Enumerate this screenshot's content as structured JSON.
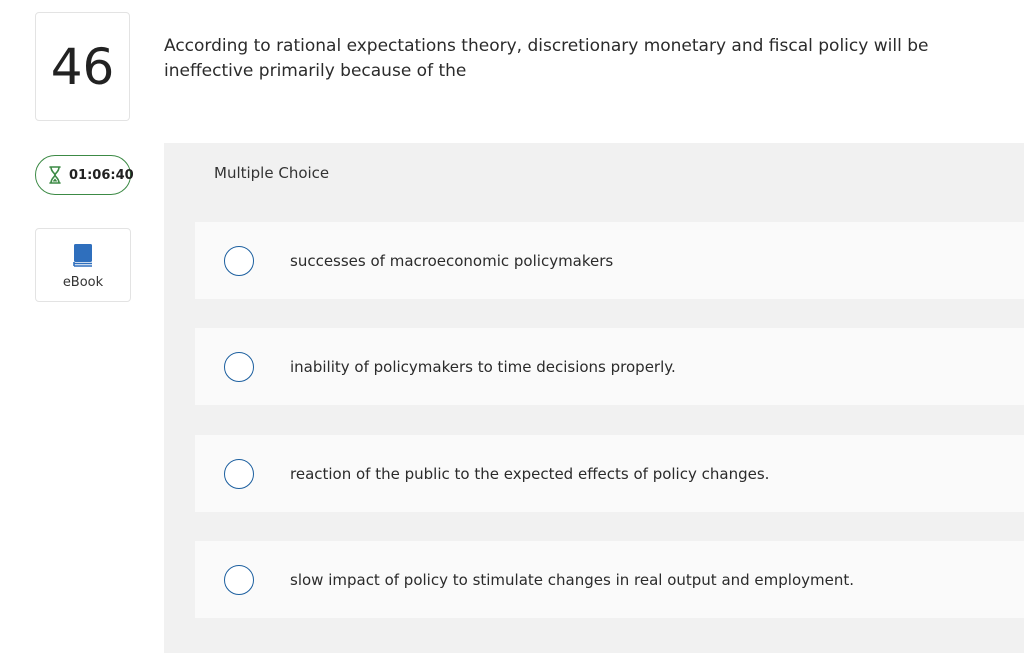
{
  "question_number": "46",
  "timer": {
    "value": "01:06:40",
    "icon": "hourglass-icon"
  },
  "ebook": {
    "label": "eBook",
    "icon": "book-icon"
  },
  "question": {
    "text": "According to rational expectations theory, discretionary monetary and fiscal policy will be ineffective primarily because of the"
  },
  "answer_panel": {
    "type_label": "Multiple Choice",
    "choices": [
      {
        "text": "successes of macroeconomic policymakers",
        "selected": false
      },
      {
        "text": "inability of policymakers to time decisions properly.",
        "selected": false
      },
      {
        "text": "reaction of the public to the expected effects of policy changes.",
        "selected": false
      },
      {
        "text": "slow impact of policy to stimulate changes in real output and employment.",
        "selected": false
      }
    ]
  },
  "colors": {
    "timer_border": "#3c8a45",
    "radio_border": "#1c5f9f",
    "book_icon": "#2f6fbd",
    "panel_bg": "#f1f1f1",
    "choice_bg": "#fafafa"
  }
}
